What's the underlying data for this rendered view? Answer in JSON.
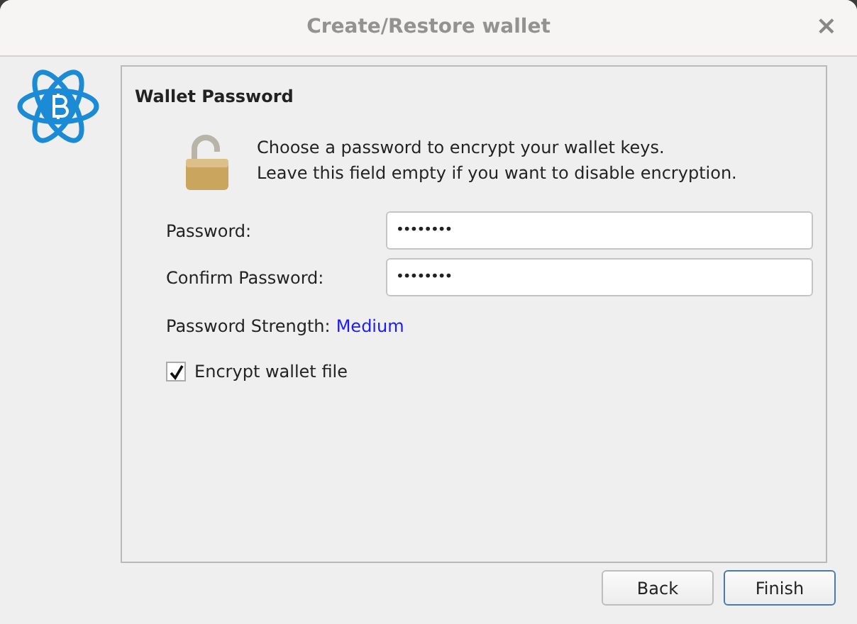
{
  "window": {
    "title": "Create/Restore wallet",
    "close": "×"
  },
  "panel": {
    "title": "Wallet Password",
    "message": [
      "Choose a password to encrypt your wallet keys.",
      "Leave this field empty if you want to disable encryption."
    ],
    "fields": [
      {
        "label": "Password:",
        "value": "••••••••"
      },
      {
        "label": "Confirm Password:",
        "value": "••••••••"
      }
    ],
    "strength": {
      "label": "Password Strength:",
      "value": "Medium"
    },
    "encrypt": {
      "label": "Encrypt wallet file",
      "checked": true
    }
  },
  "buttons": [
    {
      "label": "Back",
      "selected": false
    },
    {
      "label": "Finish",
      "selected": true
    }
  ]
}
